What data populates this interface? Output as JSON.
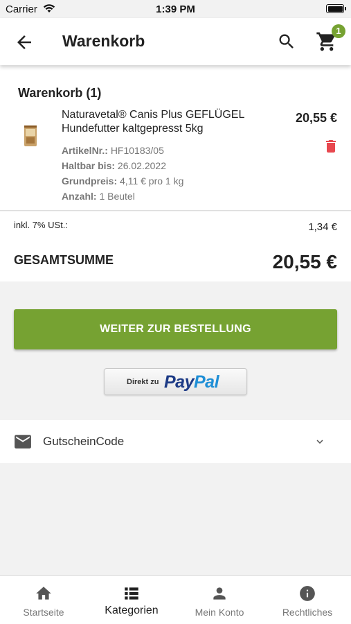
{
  "status_bar": {
    "carrier": "Carrier",
    "time": "1:39 PM"
  },
  "app_bar": {
    "title": "Warenkorb",
    "cart_count": "1",
    "accent_color": "#76a232"
  },
  "cart": {
    "heading": "Warenkorb (1)",
    "items": [
      {
        "name": "Naturavetal® Canis Plus GEFLÜGEL Hundefutter kaltgepresst 5kg",
        "price": "20,55 €",
        "article_label": "ArtikelNr.:",
        "article_value": "HF10183/05",
        "bestbefore_label": "Haltbar bis:",
        "bestbefore_value": "26.02.2022",
        "baseprice_label": "Grundpreis:",
        "baseprice_value": "4,11 € pro 1 kg",
        "quantity_label": "Anzahl:",
        "quantity_value": "1 Beutel"
      }
    ]
  },
  "summary": {
    "tax_label": "inkl. 7% USt.:",
    "tax_value": "1,34 €",
    "total_label": "GESAMTSUMME",
    "total_value": "20,55 €"
  },
  "actions": {
    "order_button": "WEITER ZUR BESTELLUNG",
    "paypal_prefix": "Direkt zu",
    "paypal_pay": "Pay",
    "paypal_pal": "Pal"
  },
  "voucher": {
    "label": "GutscheinCode"
  },
  "bottom_nav": {
    "items": [
      {
        "label": "Startseite",
        "icon": "home-icon"
      },
      {
        "label": "Kategorien",
        "icon": "list-icon",
        "active": true
      },
      {
        "label": "Mein Konto",
        "icon": "person-icon"
      },
      {
        "label": "Rechtliches",
        "icon": "info-icon"
      }
    ]
  },
  "colors": {
    "primary_green": "#76a232",
    "delete_red": "#e8484f",
    "paypal_dark": "#1d3b86",
    "paypal_light": "#1f8fd6"
  }
}
